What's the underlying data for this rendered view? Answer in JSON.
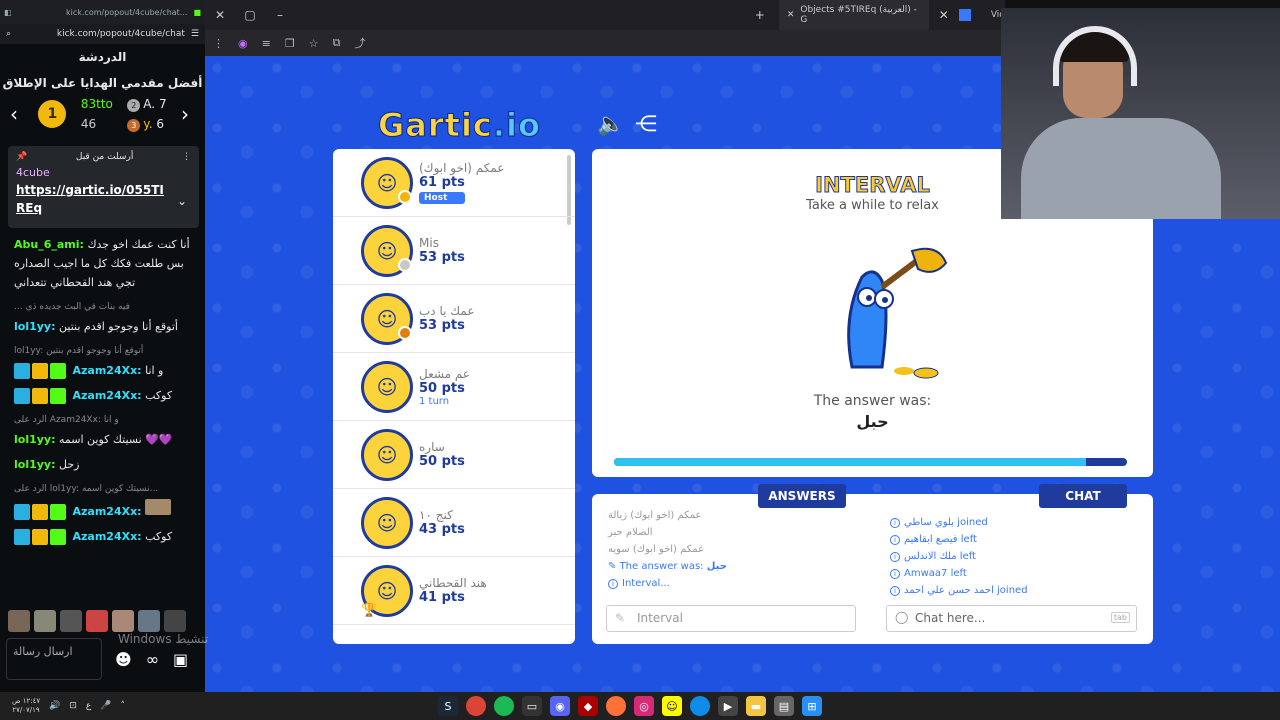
{
  "chat_window": {
    "titlebar": "kick.com/popout/4cube/chat...",
    "url": "kick.com/popout/4cube/chat",
    "title": "الدردشة",
    "gifters_title": "أفضل مقدمي الهدايا على الإطلاق",
    "gifters": [
      {
        "rank": "1",
        "user": "83tto",
        "count": "46"
      },
      {
        "rank": "2",
        "user": "A.",
        "count": "7"
      },
      {
        "rank": "3",
        "user": "y.",
        "count": "6"
      }
    ],
    "pinned": {
      "header": "أرسلت من قبل",
      "user": "4cube",
      "link": "https://gartic.io/055TIREq"
    },
    "messages": [
      {
        "user": "Abu_6_ami:",
        "text": "أنا كنت عمك اخو جدك بس طلعت فكك كل ما اجيب الصداره تجي هند القحطاني تتعداني"
      },
      {
        "reply": "... فيه بنات في البث جديده ذي",
        "user": "lol1yy:",
        "text": "أتوقع أنا وجوجو اقدم بنتين"
      },
      {
        "reply": "lol1yy: أتوقع أنا وجوجو اقدم بنتين",
        "user": "Azam24Xx:",
        "text": "و انا"
      },
      {
        "user": "Azam24Xx:",
        "text": "كوكب"
      },
      {
        "reply": "الرد على Azam24Xx: و انا",
        "user": "lol1yy:",
        "text": "نسيتك كوين اسمه 💜💜"
      },
      {
        "user": "lol1yy:",
        "text": "زحل"
      },
      {
        "reply": "الرد على lol1yy: نسيتك كوين اسمه...",
        "user": "Azam24Xx:",
        "text": ""
      },
      {
        "user": "Azam24Xx:",
        "text": "كوكب"
      }
    ],
    "input_placeholder": "ارسال رسالة",
    "watermark": "Windows تنشيط"
  },
  "browser": {
    "tab_label": "Objects #5TIREq (العربية) - G",
    "partial_tab": "Vid"
  },
  "game": {
    "logo_main": "Gartic",
    "logo_io": ".io",
    "players": [
      {
        "name": "عمكم (اخو ابوك)",
        "points": "61 pts",
        "badge": "Host",
        "dot_color": "#f5b400"
      },
      {
        "name": "Mis",
        "points": "53 pts",
        "dot_color": "#c8c8c8"
      },
      {
        "name": "عمك يا دب",
        "points": "53 pts",
        "dot_color": "#e27f12"
      },
      {
        "name": "عم مشعل",
        "points": "50 pts",
        "turn": "1 turn"
      },
      {
        "name": "ساره",
        "points": "50 pts"
      },
      {
        "name": "كنج ١٠",
        "points": "43 pts"
      },
      {
        "name": "هند القحطاني",
        "points": "41 pts",
        "crown": true
      }
    ],
    "stage": {
      "title": "INTERVAL",
      "subtitle": "Take a while to relax",
      "answer_label": "The answer was:",
      "answer": "حبل",
      "progress_fraction": 0.92
    },
    "answers_tab": "ANSWERS",
    "chat_tab": "CHAT",
    "answers_feed": [
      {
        "text": "عمكم (اخو ابوك) زبالة"
      },
      {
        "text": "الصلام حبر"
      },
      {
        "text": "عمكم (اخو ابوك) سويه"
      },
      {
        "text": "The answer was:",
        "value": "حبل",
        "highlight": true
      },
      {
        "text": "Interval...",
        "highlight": true
      }
    ],
    "chat_feed": [
      {
        "name": "بلوي ساطي",
        "action": "joined"
      },
      {
        "name": "فيصع ابقاهيم",
        "action": "left"
      },
      {
        "name": "ملك الاندلس",
        "action": "left"
      },
      {
        "name": "Amwaa7",
        "action": "left"
      },
      {
        "name": "احمد حسن علي احمد",
        "action": "joined"
      }
    ],
    "answer_input_placeholder": "Interval",
    "chat_input_placeholder": "Chat here...",
    "tab_key": "tab"
  },
  "taskbar": {
    "time": "١٢:٤٧ ص",
    "date": "٢٧/٠٧/١٩"
  }
}
